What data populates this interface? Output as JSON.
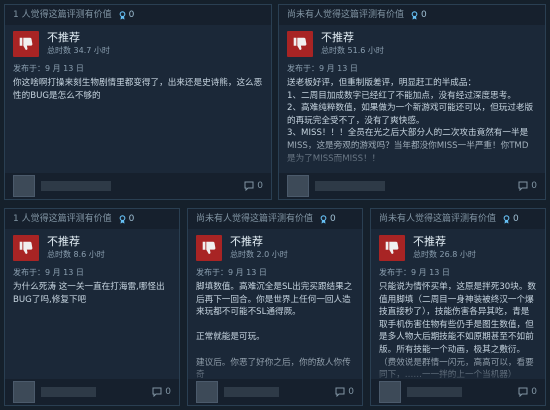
{
  "reviews": [
    {
      "helpful": "1 人觉得这篇评测有价值",
      "awards": "0",
      "title": "不推荐",
      "hours": "总时数 34.7 小时",
      "posted": "发布于：9 月 13 日",
      "body": "你这啥啊打操来刻生物剧情里都变得了，出来还是史诗熊，这么恶性的BUG是怎么不够的",
      "comments": "0"
    },
    {
      "helpful": "尚未有人觉得这篇评测有价值",
      "awards": "0",
      "title": "不推荐",
      "hours": "总时数 51.6 小时",
      "posted": "发布于：9 月 13 日",
      "body": "送老板好评，但重制版差评，明显赶工的半成品：\n1、二周目加成数字已经红了不能加点，没有经过深度思考。\n2、高难纯粹数值，如果做为一个新游戏可能还可以，但玩过老版的再玩完全受不了，没有了爽快感。\n3、MISS！！！全员在光之后大部分人的二次攻击竟然有一半是MISS，这是旁观的游戏吗？当年都没你MISS一半严重！你TMD是为了MISS而MISS！！",
      "comments": "0"
    },
    {
      "helpful": "1 人觉得这篇评测有价值",
      "awards": "0",
      "title": "不推荐",
      "hours": "总时数 8.6 小时",
      "posted": "发布于：9 月 13 日",
      "body": "为什么死涛 这一关一直在打海雷,哪怪出BUG了吗,修复下吧",
      "comments": "0"
    },
    {
      "helpful": "尚未有人觉得这篇评测有价值",
      "awards": "0",
      "title": "不推荐",
      "hours": "总时数 2.0 小时",
      "posted": "发布于：9 月 13 日",
      "body": "脚填数值。高难沉全是SL出完买跟结果之后再下一回合。你是世界上任何一回人造来玩都不可能不SL通得厥。\n\n正常就能是可玩。\n\n建议后。你恶了好你之后，你的敌人你传奇",
      "comments": "0"
    },
    {
      "helpful": "尚未有人觉得这篇评测有价值",
      "awards": "0",
      "title": "不推荐",
      "hours": "总时数 26.8 小时",
      "posted": "发布于：9 月 13 日",
      "body": "只能说为情怀买单，这原是拌死30块。数值用脚填（二周目一身神装被终汉一个爆技直接秒了），技能伤害各异其吃，青是取手机伤害住物有些仍手是图生数值，但是多人物大后期技能不如原期甚至不如前版。所有技能一个动画，极其之敷衍。（费效说是群情一闪元，高高可以，看要同下，……一一拌的上一个当机器）",
      "comments": "0"
    }
  ]
}
